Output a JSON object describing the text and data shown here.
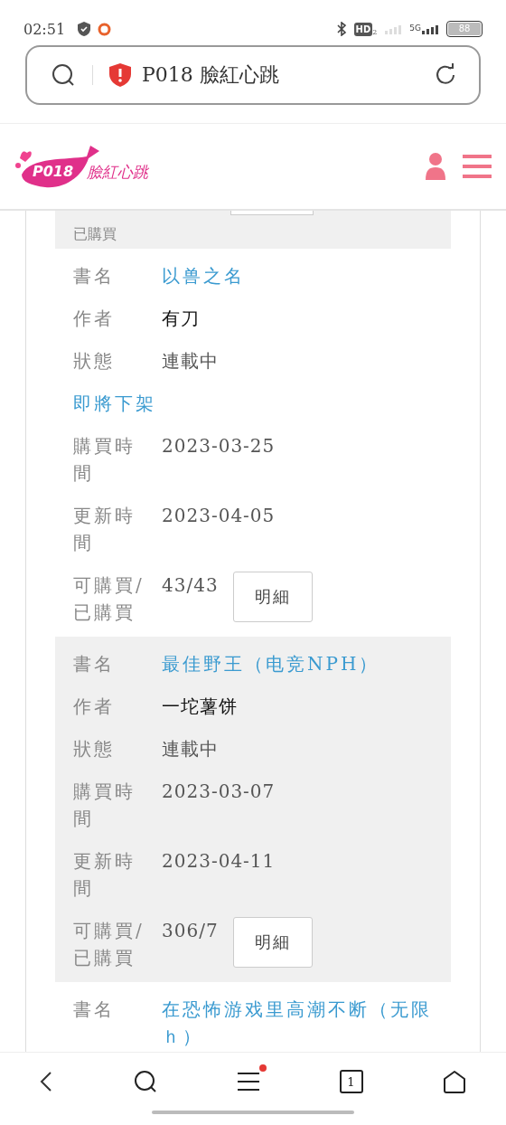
{
  "status_bar": {
    "time": "02:51",
    "hd_label": "HD",
    "hd_sub": "2",
    "network": "5G",
    "battery": "88"
  },
  "address_bar": {
    "title": "P018 臉紅心跳",
    "insecure": true
  },
  "site_header": {
    "logo_mark": "P018",
    "logo_name": "臉紅心跳"
  },
  "partial_entry": {
    "label": "已購買",
    "shaded": true
  },
  "books": [
    {
      "shaded": false,
      "title_label": "書名",
      "title": "以兽之名",
      "author_label": "作者",
      "author": "有刀",
      "status_label": "狀態",
      "status": "連載中",
      "notice": "即將下架",
      "bought_label": "購買時間",
      "bought": "2023-03-25",
      "updated_label": "更新時間",
      "updated": "2023-04-05",
      "count_label": "可購買/已購買",
      "count": "43/43",
      "detail_button": "明細"
    },
    {
      "shaded": true,
      "title_label": "書名",
      "title": "最佳野王（电竞NPH）",
      "author_label": "作者",
      "author": "一坨薯饼",
      "status_label": "狀態",
      "status": "連載中",
      "bought_label": "購買時間",
      "bought": "2023-03-07",
      "updated_label": "更新時間",
      "updated": "2023-04-11",
      "count_label": "可購買/已購買",
      "count": "306/7",
      "detail_button": "明細"
    },
    {
      "shaded": false,
      "title_label": "書名",
      "title": "在恐怖游戏里高潮不断（无限ｈ）"
    }
  ],
  "bottom_nav": {
    "tab_count": "1",
    "menu_badge": true
  }
}
